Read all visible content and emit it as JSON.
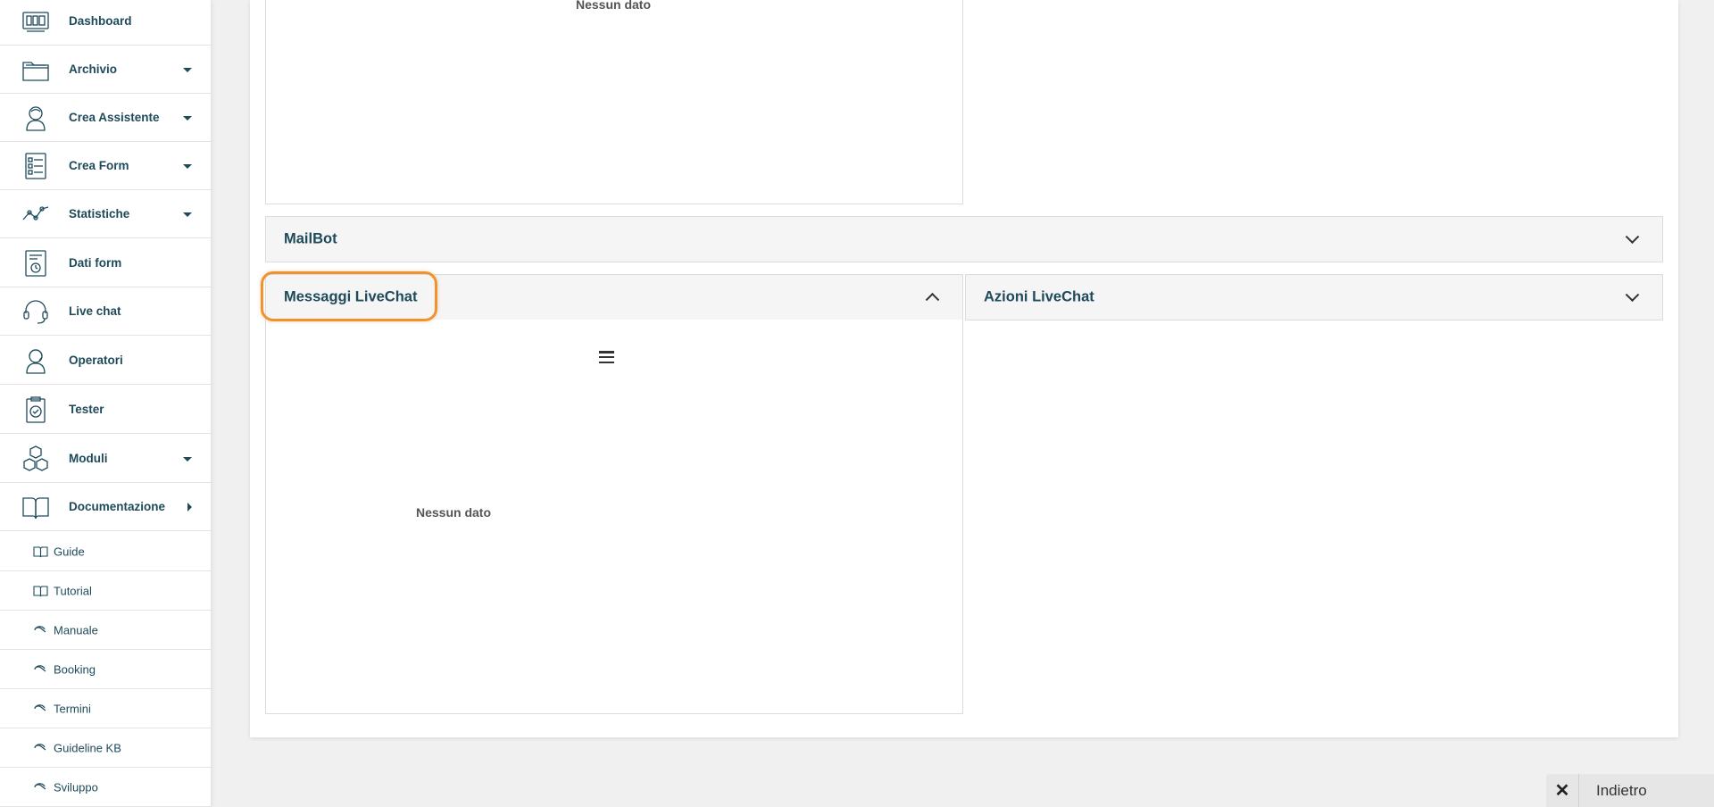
{
  "sidebar": {
    "items": [
      {
        "label": "Dashboard",
        "icon": "dashboard-icon",
        "caret": "none"
      },
      {
        "label": "Archivio",
        "icon": "folder-icon",
        "caret": "down"
      },
      {
        "label": "Crea Assistente",
        "icon": "assistant-icon",
        "caret": "down"
      },
      {
        "label": "Crea Form",
        "icon": "form-icon",
        "caret": "down"
      },
      {
        "label": "Statistiche",
        "icon": "stats-icon",
        "caret": "down"
      },
      {
        "label": "Dati form",
        "icon": "form-data-icon",
        "caret": "none"
      },
      {
        "label": "Live chat",
        "icon": "headset-icon",
        "caret": "none"
      },
      {
        "label": "Operatori",
        "icon": "operator-icon",
        "caret": "none"
      },
      {
        "label": "Tester",
        "icon": "clipboard-check-icon",
        "caret": "none"
      },
      {
        "label": "Moduli",
        "icon": "cubes-icon",
        "caret": "down"
      },
      {
        "label": "Documentazione",
        "icon": "book-icon",
        "caret": "right"
      }
    ],
    "subitems": [
      {
        "label": "Guide",
        "icon": "book-icon"
      },
      {
        "label": "Tutorial",
        "icon": "book-icon"
      },
      {
        "label": "Manuale",
        "icon": "link-icon"
      },
      {
        "label": "Booking",
        "icon": "link-icon"
      },
      {
        "label": "Termini",
        "icon": "link-icon"
      },
      {
        "label": "Guideline KB",
        "icon": "link-icon"
      },
      {
        "label": "Sviluppo",
        "icon": "link-icon"
      }
    ]
  },
  "main": {
    "top_panel": {
      "empty_text": "Nessun dato"
    },
    "mailbot": {
      "title": "MailBot",
      "state": "collapsed"
    },
    "messaggi": {
      "title": "Messaggi LiveChat",
      "state": "expanded",
      "empty_text": "Nessun dato",
      "menu_icon": "hamburger-icon"
    },
    "azioni": {
      "title": "Azioni LiveChat",
      "state": "collapsed"
    }
  },
  "back_button": {
    "close_glyph": "✕",
    "label": "Indietro"
  },
  "colors": {
    "accent": "#1e4a5a",
    "highlight": "#f0922f",
    "background": "#f0f0f0"
  }
}
